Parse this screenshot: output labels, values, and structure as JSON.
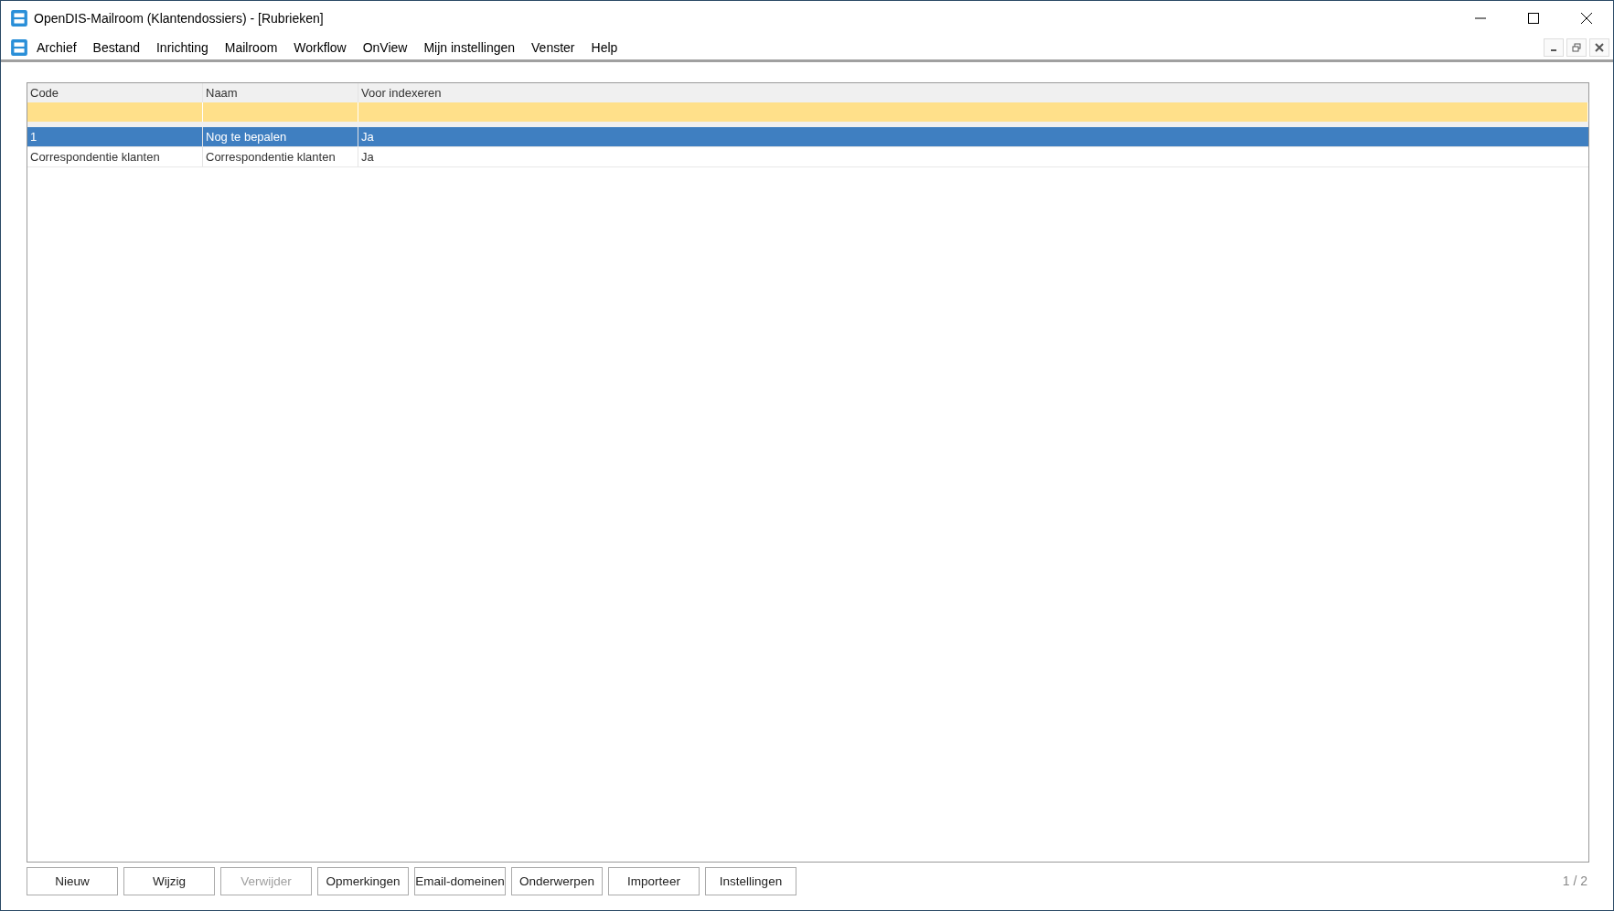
{
  "window": {
    "title": "OpenDIS-Mailroom (Klantendossiers) - [Rubrieken]"
  },
  "menu": [
    "Archief",
    "Bestand",
    "Inrichting",
    "Mailroom",
    "Workflow",
    "OnView",
    "Mijn instellingen",
    "Venster",
    "Help"
  ],
  "table": {
    "columns": [
      "Code",
      "Naam",
      "Voor indexeren"
    ],
    "rows": [
      {
        "cells": [
          "1",
          "Nog te bepalen",
          "Ja"
        ],
        "selected": true
      },
      {
        "cells": [
          "Correspondentie klanten",
          "Correspondentie klanten",
          "Ja"
        ],
        "selected": false
      }
    ]
  },
  "buttons": [
    {
      "label": "Nieuw",
      "disabled": false
    },
    {
      "label": "Wijzig",
      "disabled": false
    },
    {
      "label": "Verwijder",
      "disabled": true
    },
    {
      "label": "Opmerkingen",
      "disabled": false
    },
    {
      "label": "Email-domeinen",
      "disabled": false
    },
    {
      "label": "Onderwerpen",
      "disabled": false
    },
    {
      "label": "Importeer",
      "disabled": false
    },
    {
      "label": "Instellingen",
      "disabled": false
    }
  ],
  "page_counter": "1 / 2"
}
